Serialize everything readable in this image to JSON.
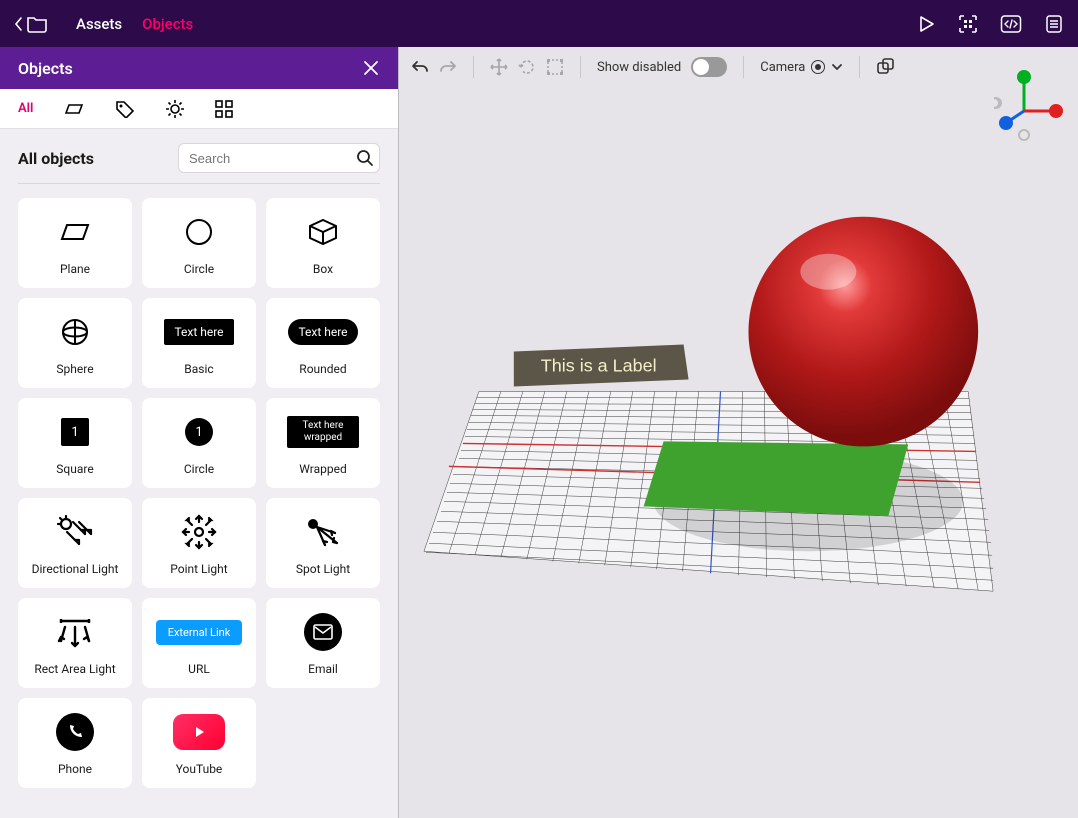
{
  "topbar": {
    "tabs": {
      "assets": "Assets",
      "objects": "Objects"
    }
  },
  "panel": {
    "title": "Objects",
    "filters": {
      "all": "All"
    },
    "section_title": "All objects",
    "search_placeholder": "Search"
  },
  "objects": {
    "plane": "Plane",
    "circle": "Circle",
    "box": "Box",
    "sphere": "Sphere",
    "basic": "Basic",
    "basic_chip": "Text here",
    "rounded": "Rounded",
    "rounded_chip": "Text here",
    "square": "Square",
    "square_num": "1",
    "circle2": "Circle",
    "circle2_num": "1",
    "wrapped": "Wrapped",
    "wrapped_chip": "Text here wrapped",
    "dir_light": "Directional Light",
    "point_light": "Point Light",
    "spot_light": "Spot Light",
    "rect_area_light": "Rect Area Light",
    "url": "URL",
    "url_chip": "External Link",
    "email": "Email",
    "phone": "Phone",
    "youtube": "YouTube"
  },
  "canvasbar": {
    "show_disabled": "Show disabled",
    "camera": "Camera"
  },
  "scene": {
    "label_text": "This is a Label"
  }
}
